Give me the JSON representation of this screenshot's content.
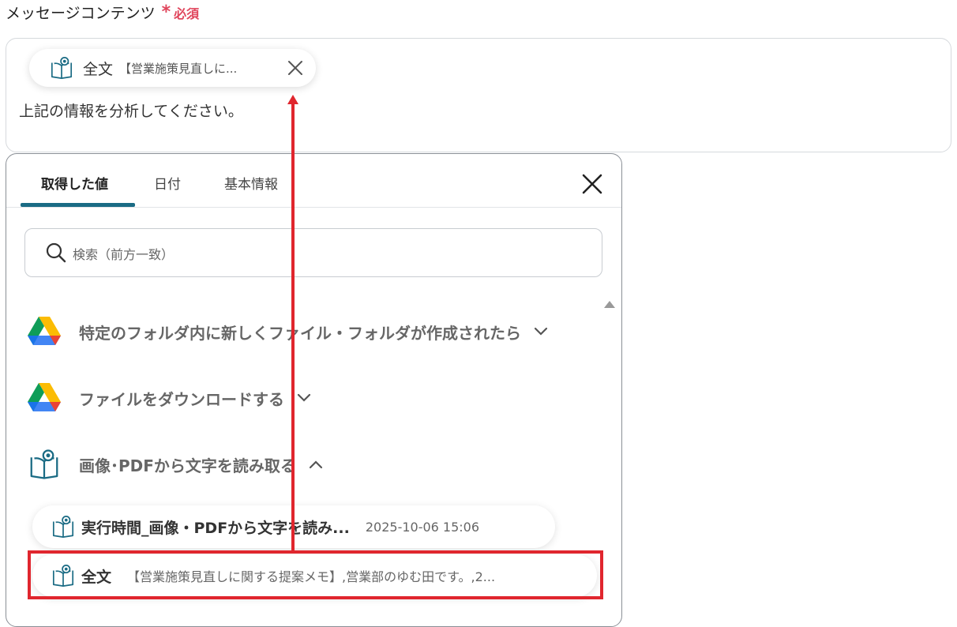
{
  "field": {
    "label": "メッセージコンテンツ",
    "required_mark": "*",
    "required_text": "必須"
  },
  "message": {
    "chip": {
      "name": "全文",
      "value": "【営業施策見直しに..."
    },
    "text": "上記の情報を分析してください。"
  },
  "panel": {
    "tabs": [
      {
        "label": "取得した値"
      },
      {
        "label": "日付"
      },
      {
        "label": "基本情報"
      }
    ],
    "search": {
      "placeholder": "検索（前方一致）"
    },
    "sections": [
      {
        "label": "特定のフォルダ内に新しくファイル・フォルダが作成されたら",
        "icon": "google-drive-icon",
        "expanded": false
      },
      {
        "label": "ファイルをダウンロードする",
        "icon": "google-drive-icon",
        "expanded": false
      },
      {
        "label": "画像･PDFから文字を読み取る",
        "icon": "ocr-book-icon",
        "expanded": true
      }
    ],
    "items": [
      {
        "name": "実行時間_画像・PDFから文字を読み...",
        "value": "2025-10-06 15:06"
      },
      {
        "name": "全文",
        "value": "【営業施策見直しに関する提案メモ】,営業部のゆむ田です。,2..."
      }
    ]
  },
  "colors": {
    "accent": "#1a6b84",
    "required": "#e0455c",
    "highlight": "#e0262e"
  }
}
